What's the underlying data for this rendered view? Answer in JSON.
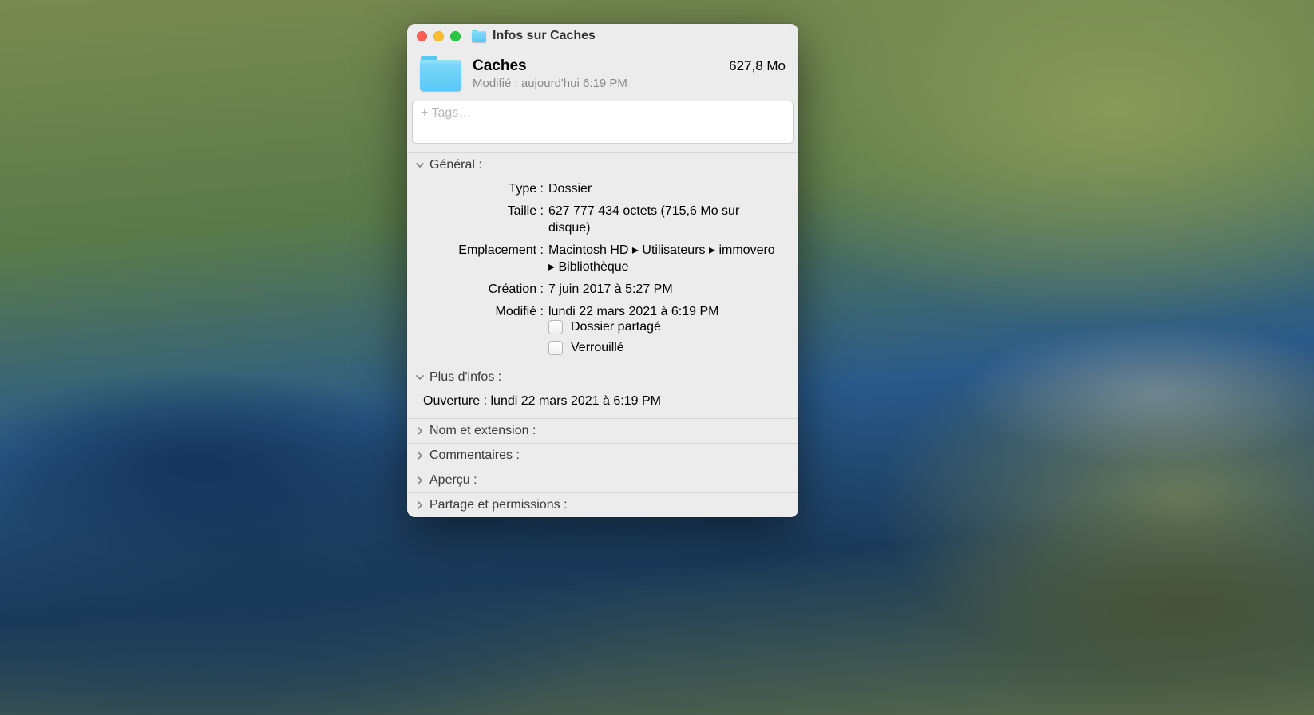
{
  "window": {
    "title": "Infos sur Caches"
  },
  "summary": {
    "name": "Caches",
    "size": "627,8 Mo",
    "modified_prefix": "Modifié :",
    "modified_value": "aujourd'hui 6:19 PM"
  },
  "tags": {
    "placeholder": "+ Tags…"
  },
  "sections": {
    "general": {
      "title": "Général :",
      "fields": {
        "type_label": "Type :",
        "type_value": "Dossier",
        "size_label": "Taille :",
        "size_value": "627 777 434 octets (715,6 Mo sur disque)",
        "location_label": "Emplacement :",
        "location_value": "Macintosh HD ▸ Utilisateurs ▸ immovero ▸ Bibliothèque",
        "created_label": "Création :",
        "created_value": "7 juin 2017 à 5:27 PM",
        "modified_label": "Modifié :",
        "modified_value": "lundi 22 mars 2021 à 6:19 PM"
      },
      "checks": {
        "shared": "Dossier partagé",
        "locked": "Verrouillé"
      }
    },
    "more_info": {
      "title": "Plus d'infos :",
      "opened_label": "Ouverture :",
      "opened_value": "lundi 22 mars 2021 à 6:19 PM"
    },
    "name_ext": {
      "title": "Nom et extension :"
    },
    "comments": {
      "title": "Commentaires :"
    },
    "preview": {
      "title": "Aperçu :"
    },
    "sharing": {
      "title": "Partage et permissions :"
    }
  }
}
